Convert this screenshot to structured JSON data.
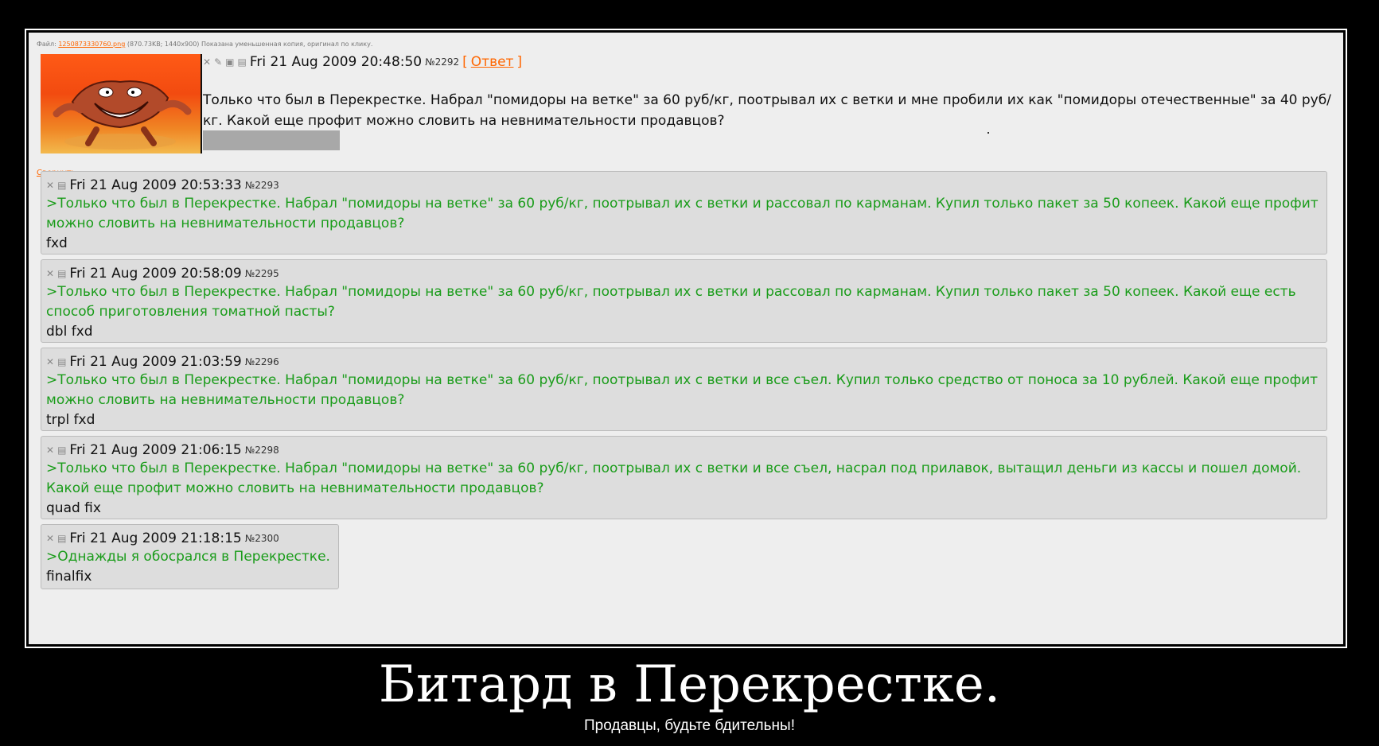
{
  "file_info": {
    "label": "Файл:",
    "filename": "1250873330760.png",
    "details": "(870.73KB; 1440x900) Показана уменьшенная копия, оригинал по клику."
  },
  "op": {
    "icons": [
      "close-icon",
      "edit-icon",
      "hide-icon",
      "report-icon"
    ],
    "date": "Fri 21 Aug 2009 20:48:50",
    "number": "№2292",
    "reply_label": "Ответ",
    "text": "Только что был в Перекрестке. Набрал \"помидоры на ветке\" за 60 руб/кг, поотрывал их с ветки и мне пробили их как \"помидоры отечественные\" за 40 руб/кг. Какой еще профит можно словить на невнимательности продавцов?"
  },
  "collapse_label": "Свернуть",
  "replies": [
    {
      "date": "Fri 21 Aug 2009 20:53:33",
      "number": "№2293",
      "quote": ">Только что был в Перекрестке. Набрал \"помидоры на ветке\" за 60 руб/кг, поотрывал их с ветки и рассовал по карманам. Купил только пакет за 50 копеек. Какой еще профит можно словить на невнимательности продавцов?",
      "text": "fxd"
    },
    {
      "date": "Fri 21 Aug 2009 20:58:09",
      "number": "№2295",
      "quote": ">Только что был в Перекрестке. Набрал \"помидоры на ветке\" за 60 руб/кг, поотрывал их с ветки и рассовал по карманам. Купил только пакет за 50 копеек. Какой еще есть способ приготовления томатной пасты?",
      "text": "dbl fxd"
    },
    {
      "date": "Fri 21 Aug 2009 21:03:59",
      "number": "№2296",
      "quote": ">Только что был в Перекрестке. Набрал \"помидоры на ветке\" за 60 руб/кг, поотрывал их с ветки и все съел. Купил только средство от поноса за 10 рублей. Какой еще профит можно словить на невнимательности продавцов?",
      "text": "trpl fxd"
    },
    {
      "date": "Fri 21 Aug 2009 21:06:15",
      "number": "№2298",
      "quote": ">Только что был в Перекрестке. Набрал \"помидоры на ветке\" за 60 руб/кг, поотрывал их с ветки и все съел, насрал под прилавок, вытащил деньги из кассы и пошел домой. Какой еще профит можно словить на невнимательности продавцов?",
      "text": "quad fix"
    },
    {
      "date": "Fri 21 Aug 2009 21:18:15",
      "number": "№2300",
      "quote": ">Однажды я обосрался в Перекрестке.",
      "text": "finalfix"
    }
  ],
  "caption": {
    "title": "Битард в Перекрестке.",
    "subtitle": "Продавцы, будьте бдительны!"
  },
  "colors": {
    "background": "#000000",
    "board": "#eeeeee",
    "reply_bg": "#dddddd",
    "quote": "#1a9c1a",
    "link": "#ff6600"
  }
}
